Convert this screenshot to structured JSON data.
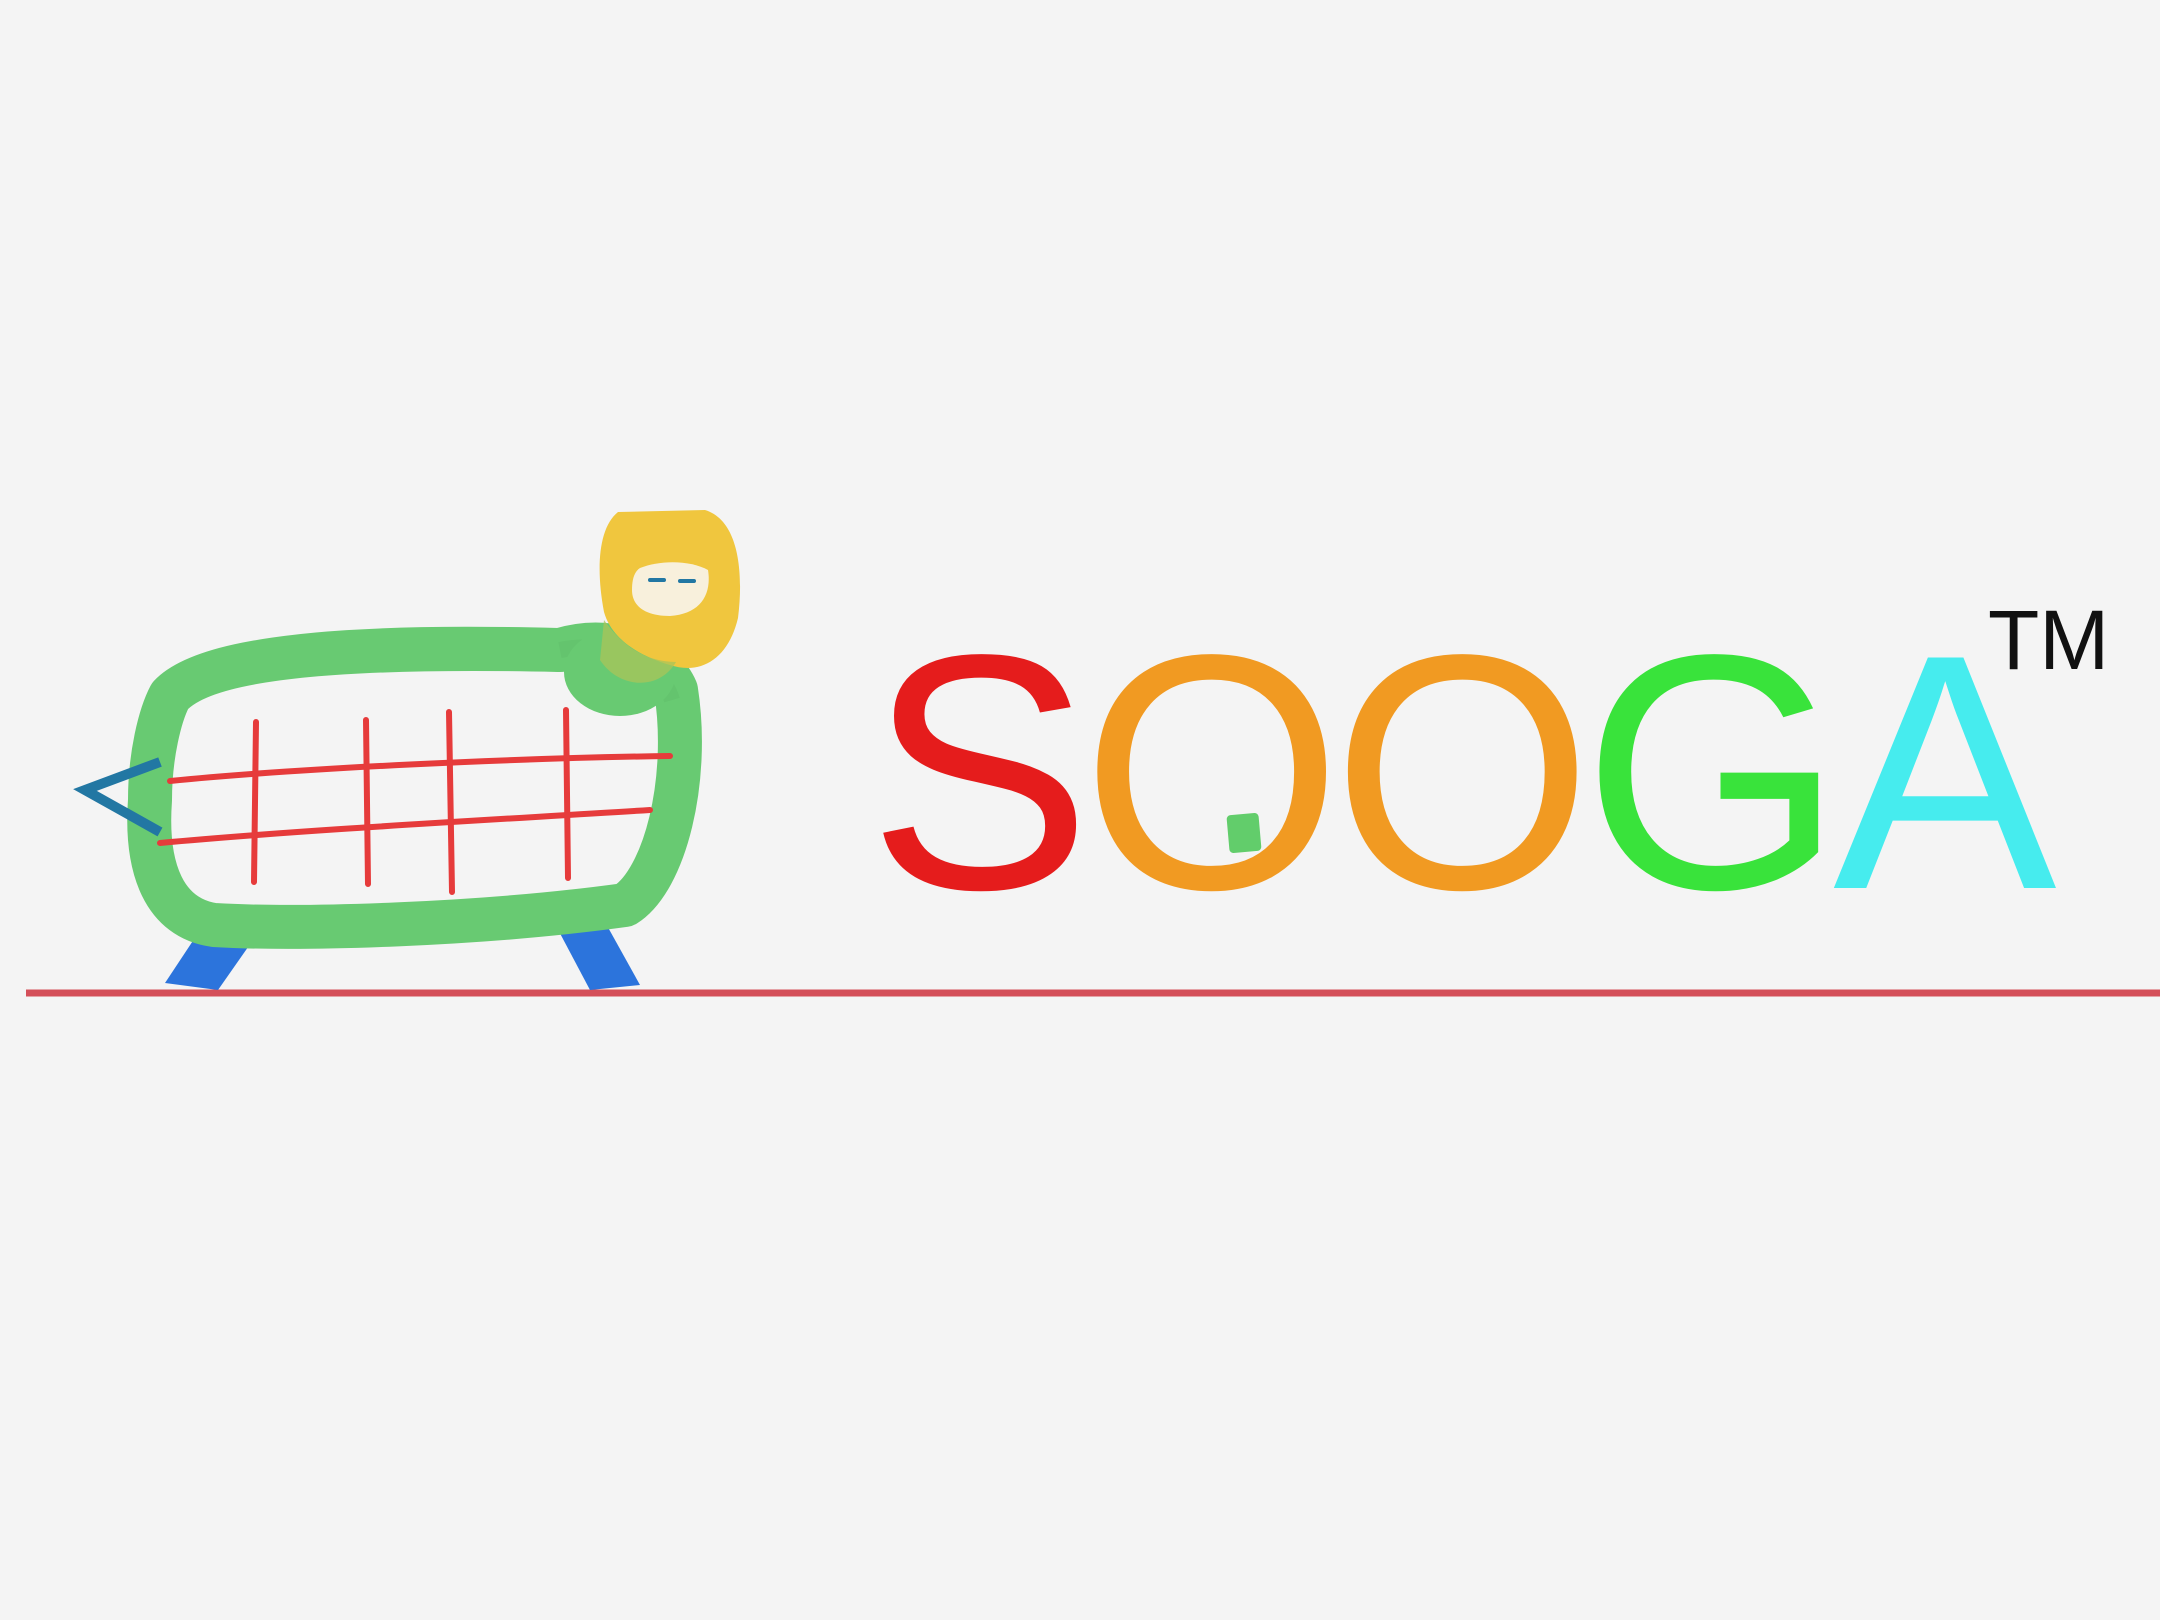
{
  "logo": {
    "wordmark": {
      "letters": [
        {
          "char": "S",
          "color": "#e51c1c"
        },
        {
          "char": "O",
          "color": "#f19a22"
        },
        {
          "char": "O",
          "color": "#f19a22"
        },
        {
          "char": "G",
          "color": "#39e33b"
        },
        {
          "char": "A",
          "color": "#46ecee"
        }
      ]
    },
    "trademark": "TM"
  },
  "colors": {
    "background": "#f4f4f4",
    "ground_line": "#d44f59",
    "body": "#68ca72",
    "grid": "#e63b3b",
    "head": "#f0c63e",
    "legs": "#2c74dc",
    "beak": "#2277a3",
    "o_dot": "#62cd6b"
  }
}
